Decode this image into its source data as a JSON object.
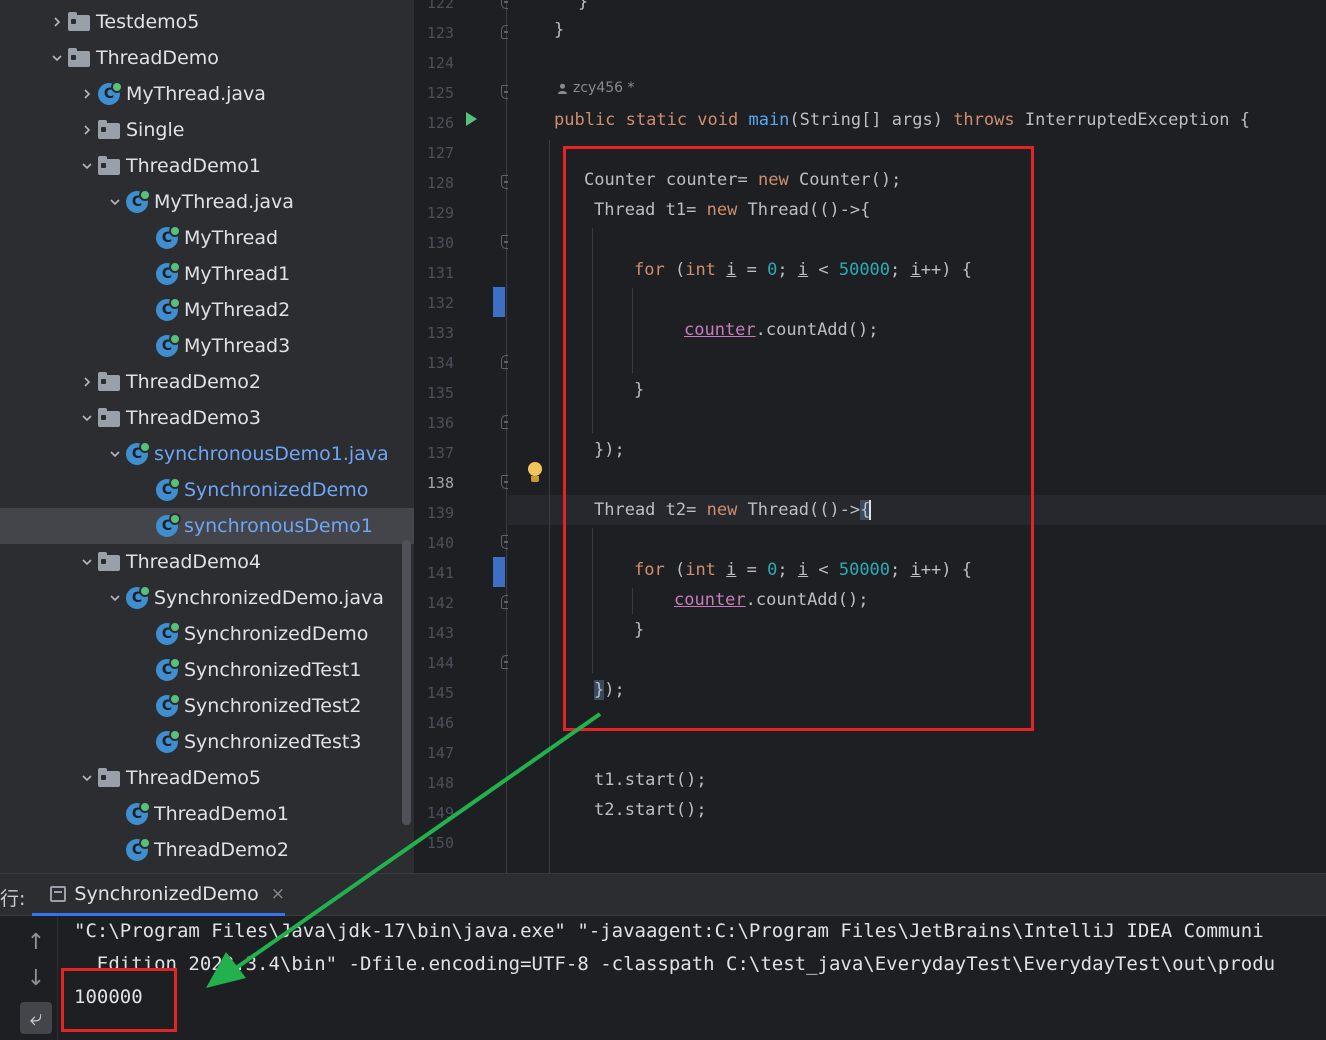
{
  "project_tree": [
    {
      "label": "Testdemo5",
      "icon": "folder-icon",
      "indent": 0,
      "chevron": "right"
    },
    {
      "label": "ThreadDemo",
      "icon": "folder-icon",
      "indent": 0,
      "chevron": "down"
    },
    {
      "label": "MyThread.java",
      "icon": "java-class-icon",
      "indent": 1,
      "chevron": "right"
    },
    {
      "label": "Single",
      "icon": "folder-icon",
      "indent": 1,
      "chevron": "right"
    },
    {
      "label": "ThreadDemo1",
      "icon": "folder-icon",
      "indent": 1,
      "chevron": "down"
    },
    {
      "label": "MyThread.java",
      "icon": "java-class-icon",
      "indent": 2,
      "chevron": "down"
    },
    {
      "label": "MyThread",
      "icon": "java-class-icon",
      "indent": 3,
      "chevron": ""
    },
    {
      "label": "MyThread1",
      "icon": "java-class-icon",
      "indent": 3,
      "chevron": ""
    },
    {
      "label": "MyThread2",
      "icon": "java-class-icon",
      "indent": 3,
      "chevron": ""
    },
    {
      "label": "MyThread3",
      "icon": "java-class-icon",
      "indent": 3,
      "chevron": ""
    },
    {
      "label": "ThreadDemo2",
      "icon": "folder-icon",
      "indent": 1,
      "chevron": "right"
    },
    {
      "label": "ThreadDemo3",
      "icon": "folder-icon",
      "indent": 1,
      "chevron": "down"
    },
    {
      "label": "synchronousDemo1.java",
      "icon": "java-class-icon",
      "indent": 2,
      "chevron": "down",
      "modified": true
    },
    {
      "label": "SynchronizedDemo",
      "icon": "java-class-icon",
      "indent": 3,
      "chevron": "",
      "modified": true
    },
    {
      "label": "synchronousDemo1",
      "icon": "java-class-icon",
      "indent": 3,
      "chevron": "",
      "modified": true,
      "selected": true
    },
    {
      "label": "ThreadDemo4",
      "icon": "folder-icon",
      "indent": 1,
      "chevron": "down"
    },
    {
      "label": "SynchronizedDemo.java",
      "icon": "java-class-icon",
      "indent": 2,
      "chevron": "down"
    },
    {
      "label": "SynchronizedDemo",
      "icon": "java-class-icon",
      "indent": 3,
      "chevron": ""
    },
    {
      "label": "SynchronizedTest1",
      "icon": "java-class-icon",
      "indent": 3,
      "chevron": ""
    },
    {
      "label": "SynchronizedTest2",
      "icon": "java-class-icon",
      "indent": 3,
      "chevron": ""
    },
    {
      "label": "SynchronizedTest3",
      "icon": "java-class-icon",
      "indent": 3,
      "chevron": ""
    },
    {
      "label": "ThreadDemo5",
      "icon": "folder-icon",
      "indent": 1,
      "chevron": "down"
    },
    {
      "label": "ThreadDemo1",
      "icon": "java-class-icon",
      "indent": 2,
      "chevron": ""
    },
    {
      "label": "ThreadDemo2",
      "icon": "java-class-icon",
      "indent": 2,
      "chevron": ""
    }
  ],
  "editor": {
    "line_numbers": [
      "122",
      "123",
      "124",
      "125",
      "126",
      "127",
      "128",
      "129",
      "130",
      "131",
      "132",
      "133",
      "134",
      "135",
      "136",
      "137",
      "138",
      "139",
      "140",
      "141",
      "142",
      "143",
      "144",
      "145",
      "146",
      "147",
      "148",
      "149",
      "150"
    ],
    "current_line": "138",
    "author_hint": "zcy456 *",
    "code": {
      "l122": "}",
      "l123": "}",
      "l125_kw1": "public static void ",
      "l125_fn": "main",
      "l125_mid": "(String[] args) ",
      "l125_kw2": "throws",
      "l125_tail": " InterruptedException {",
      "l127_a": "Counter counter= ",
      "l127_kw": "new",
      "l127_b": " Counter();",
      "l128_a": "Thread t1= ",
      "l128_kw": "new",
      "l128_b": " Thread(()->{",
      "for_kw": "for",
      "for_p1": " (",
      "for_int": "int",
      "for_sp": " ",
      "for_i": "i",
      "for_eq": " = ",
      "for_zero": "0",
      "for_semi": "; ",
      "for_lt": " < ",
      "for_limit": "50000",
      "for_semi2": "; ",
      "for_inc": "++) {",
      "counter_field": "counter",
      "count_call": ".countAdd();",
      "close_brace": "}",
      "close_lambda": "});",
      "l138_a": "Thread t2= ",
      "l138_kw": "new",
      "l138_b": " Thread(()->",
      "l138_brace": "{",
      "l144_brace": "}",
      "l144_rest": ");",
      "l147": "t1.start();",
      "l148": "t2.start();"
    }
  },
  "run_panel": {
    "caption": "行:",
    "tab_label": "SynchronizedDemo",
    "tab_close": "×",
    "output_lines": [
      "\"C:\\Program Files\\Java\\jdk-17\\bin\\java.exe\" \"-javaagent:C:\\Program Files\\JetBrains\\IntelliJ IDEA Communi",
      "  Edition 2022.3.4\\bin\" -Dfile.encoding=UTF-8 -classpath C:\\test_java\\EverydayTest\\EverydayTest\\out\\produ",
      "100000"
    ],
    "toolbar": [
      {
        "icon": "arrow-up-icon",
        "glyph": "↑"
      },
      {
        "icon": "arrow-down-icon",
        "glyph": "↓"
      },
      {
        "icon": "soft-wrap-icon",
        "glyph": "⤶"
      }
    ]
  },
  "colors": {
    "highlight_box": "#e32424",
    "annotation_arrow": "#23b14d",
    "selection": "#43454a",
    "modified_file": "#6fa5f5"
  }
}
